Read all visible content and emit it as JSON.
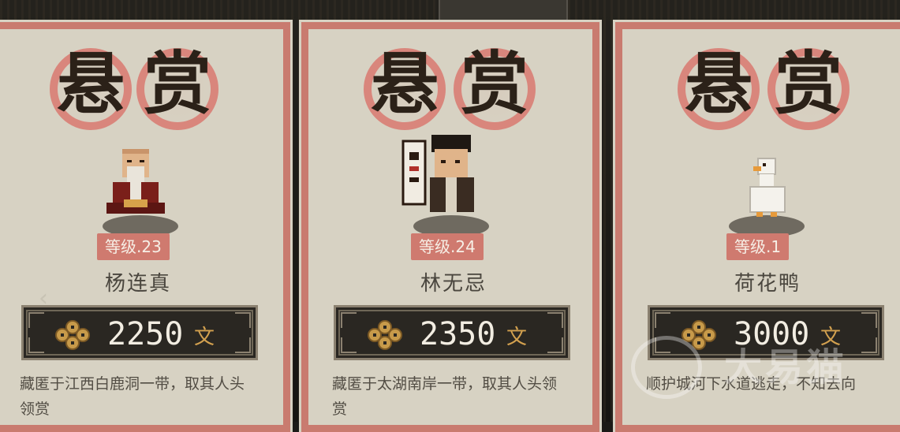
{
  "top_tab": "",
  "stamp_chars": [
    "悬",
    "赏"
  ],
  "currency_unit": "文",
  "cards": [
    {
      "level": "等级.23",
      "name": "杨连真",
      "amount": "2250",
      "description": "藏匿于江西白鹿洞一带，取其人头领赏",
      "portrait": "bald-elder-monk-icon"
    },
    {
      "level": "等级.24",
      "name": "林无忌",
      "amount": "2350",
      "description": "藏匿于太湖南岸一带，取其人头领赏",
      "portrait": "young-swordsman-with-banner-icon"
    },
    {
      "level": "等级.1",
      "name": "荷花鸭",
      "amount": "3000",
      "description": "顺护城河下水道逃走，不知去向",
      "portrait": "white-duck-icon"
    }
  ],
  "nav": {
    "prev_arrow": "‹"
  },
  "watermark": "大易猫",
  "colors": {
    "card_bg": "#d7d2c3",
    "card_border": "#c97b6f",
    "level_badge": "#cf7a6f",
    "bounty_bg": "#2a2722",
    "coin": "#c79a4a"
  }
}
